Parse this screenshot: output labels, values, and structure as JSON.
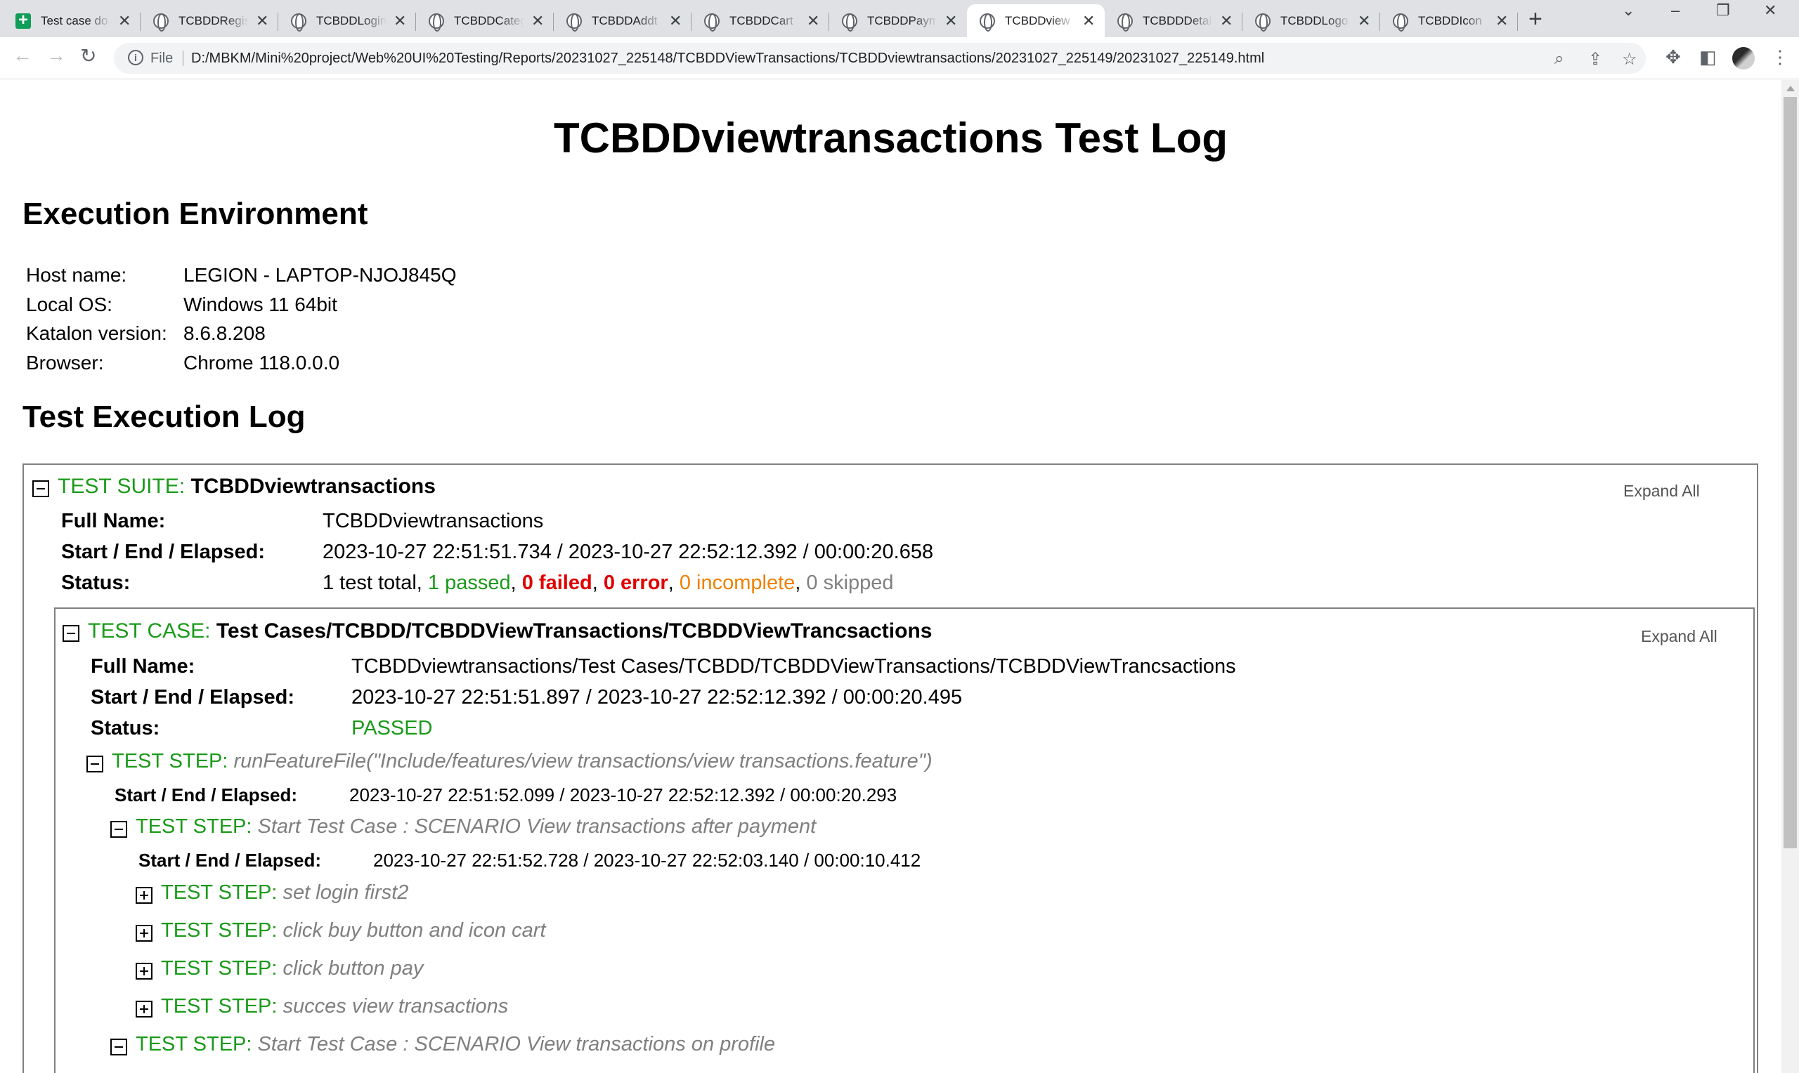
{
  "browser": {
    "tabs": [
      {
        "label": "Test case do",
        "icon": "sheets-icon"
      },
      {
        "label": "TCBDDRegis",
        "icon": "globe-icon"
      },
      {
        "label": "TCBDDLogin",
        "icon": "globe-icon"
      },
      {
        "label": "TCBDDCateg",
        "icon": "globe-icon"
      },
      {
        "label": "TCBDDAddt",
        "icon": "globe-icon"
      },
      {
        "label": "TCBDDCart",
        "icon": "globe-icon"
      },
      {
        "label": "TCBDDPaym",
        "icon": "globe-icon"
      },
      {
        "label": "TCBDDview",
        "icon": "globe-icon",
        "active": true
      },
      {
        "label": "TCBDDDetai",
        "icon": "globe-icon"
      },
      {
        "label": "TCBDDLogo",
        "icon": "globe-icon"
      },
      {
        "label": "TCBDDIcon",
        "icon": "globe-icon"
      }
    ],
    "scheme_label": "File",
    "url": "D:/MBKM/Mini%20project/Web%20UI%20Testing/Reports/20231027_225148/TCBDDViewTransactions/TCBDDviewtransactions/20231027_225149/20231027_225149.html"
  },
  "page": {
    "title": "TCBDDviewtransactions Test Log",
    "env_heading": "Execution Environment",
    "env": [
      {
        "key": "Host name:",
        "value": "LEGION - LAPTOP-NJOJ845Q"
      },
      {
        "key": "Local OS:",
        "value": "Windows 11 64bit"
      },
      {
        "key": "Katalon version:",
        "value": "8.6.8.208"
      },
      {
        "key": "Browser:",
        "value": "Chrome 118.0.0.0"
      }
    ],
    "log_heading": "Test Execution Log",
    "suite": {
      "prefix": "TEST SUITE: ",
      "name": "TCBDDviewtransactions",
      "expand_all": "Expand All",
      "full_name_label": "Full Name:",
      "full_name": "TCBDDviewtransactions",
      "timing_label": "Start / End / Elapsed:",
      "timing": "2023-10-27 22:51:51.734 / 2023-10-27 22:52:12.392 / 00:00:20.658",
      "status_label": "Status:",
      "status": {
        "total": "1 test total, ",
        "passed": "1 passed",
        "sep1": ", ",
        "failed": "0 failed",
        "sep2": ", ",
        "error": "0 error",
        "sep3": ", ",
        "incomplete": "0 incomplete",
        "sep4": ", ",
        "skipped": "0 skipped"
      }
    },
    "case": {
      "prefix": "TEST CASE: ",
      "name": "Test Cases/TCBDD/TCBDDViewTransactions/TCBDDViewTrancsactions",
      "expand_all": "Expand All",
      "full_name_label": "Full Name:",
      "full_name": "TCBDDviewtransactions/Test Cases/TCBDD/TCBDDViewTransactions/TCBDDViewTrancsactions",
      "timing_label": "Start / End / Elapsed:",
      "timing": "2023-10-27 22:51:51.897 / 2023-10-27 22:52:12.392 / 00:00:20.495",
      "status_label": "Status:",
      "status": "PASSED"
    },
    "steps": {
      "prefix": "TEST STEP: ",
      "timing_label": "Start / End / Elapsed:",
      "feature": {
        "desc": "runFeatureFile(\"Include/features/view transactions/view transactions.feature\")",
        "timing": "2023-10-27 22:51:52.099 / 2023-10-27 22:52:12.392 / 00:00:20.293"
      },
      "scenario1": {
        "desc": "Start Test Case : SCENARIO View transactions after payment",
        "timing": "2023-10-27 22:51:52.728 / 2023-10-27 22:52:03.140 / 00:00:10.412"
      },
      "sub": [
        "set login first2",
        "click buy button and icon cart",
        "click button pay",
        "succes view transactions"
      ],
      "scenario2": {
        "desc": "Start Test Case : SCENARIO View transactions on profile"
      }
    }
  }
}
